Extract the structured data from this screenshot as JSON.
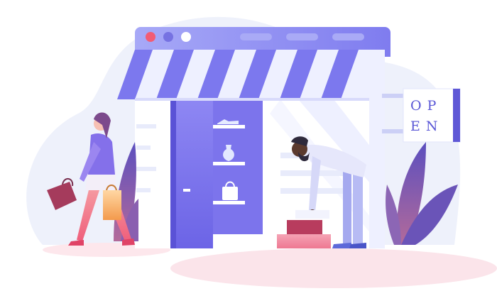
{
  "illustration": {
    "sign": {
      "line1": "O P",
      "line2": "E N"
    },
    "palette": {
      "window_blue": "#8e8cf0",
      "stripe_purple": "#7c78ee",
      "stripe_light": "#eef0ff",
      "door": "#7d76ee",
      "backdrop": "#eef1fb",
      "floor_pink": "#fbe4ea",
      "leaf_purple": "#6f56b8",
      "box_pink": "#ef6f86",
      "bag_orange": "#f2a24a",
      "dot_red": "#f25b74",
      "dot_indigo": "#7672e2",
      "dot_white": "#ffffff"
    },
    "icons": [
      "browser-dots-icon",
      "awning",
      "open-sign",
      "shopper-woman",
      "bending-man",
      "shoe-icon",
      "vase-icon",
      "handbag-icon"
    ]
  }
}
